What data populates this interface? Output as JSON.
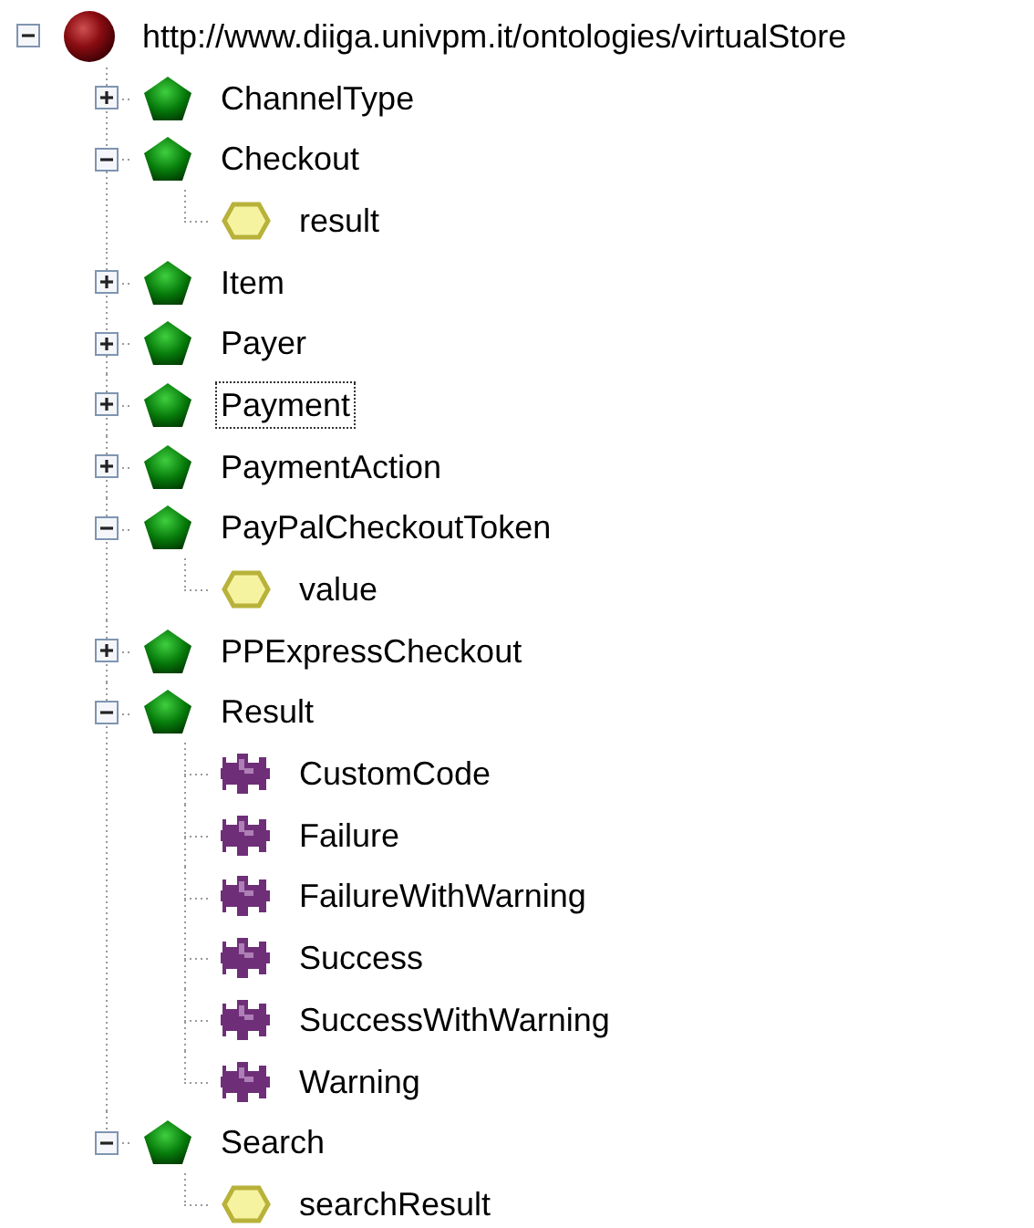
{
  "tree": {
    "label": "http://www.diiga.univpm.it/ontologies/virtualStore",
    "kind": "ontology",
    "expanded": true,
    "selected": false,
    "children": [
      {
        "label": "ChannelType",
        "kind": "class",
        "expanded": false,
        "selected": false
      },
      {
        "label": "Checkout",
        "kind": "class",
        "expanded": true,
        "selected": false,
        "children": [
          {
            "label": "result",
            "kind": "property",
            "selected": false
          }
        ]
      },
      {
        "label": "Item",
        "kind": "class",
        "expanded": false,
        "selected": false
      },
      {
        "label": "Payer",
        "kind": "class",
        "expanded": false,
        "selected": false
      },
      {
        "label": "Payment",
        "kind": "class",
        "expanded": false,
        "selected": true
      },
      {
        "label": "PaymentAction",
        "kind": "class",
        "expanded": false,
        "selected": false
      },
      {
        "label": "PayPalCheckoutToken",
        "kind": "class",
        "expanded": true,
        "selected": false,
        "children": [
          {
            "label": "value",
            "kind": "property",
            "selected": false
          }
        ]
      },
      {
        "label": "PPExpressCheckout",
        "kind": "class",
        "expanded": false,
        "selected": false
      },
      {
        "label": "Result",
        "kind": "class",
        "expanded": true,
        "selected": false,
        "children": [
          {
            "label": "CustomCode",
            "kind": "individual",
            "selected": false
          },
          {
            "label": "Failure",
            "kind": "individual",
            "selected": false
          },
          {
            "label": "FailureWithWarning",
            "kind": "individual",
            "selected": false
          },
          {
            "label": "Success",
            "kind": "individual",
            "selected": false
          },
          {
            "label": "SuccessWithWarning",
            "kind": "individual",
            "selected": false
          },
          {
            "label": "Warning",
            "kind": "individual",
            "selected": false
          }
        ]
      },
      {
        "label": "Search",
        "kind": "class",
        "expanded": true,
        "selected": false,
        "children": [
          {
            "label": "searchResult",
            "kind": "property",
            "selected": false
          }
        ]
      }
    ]
  }
}
